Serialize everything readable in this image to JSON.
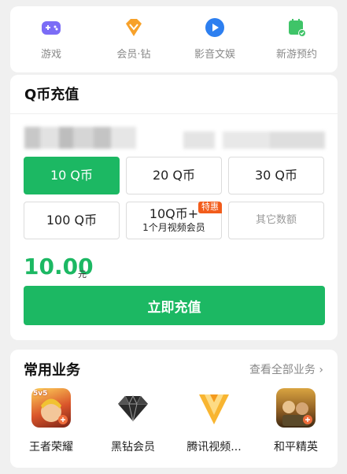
{
  "top_nav": {
    "items": [
      {
        "label": "游戏",
        "icon": "gamepad-icon",
        "color": "#7b6cf6"
      },
      {
        "label": "会员·钻",
        "icon": "diamond-icon",
        "color": "#f7a12a"
      },
      {
        "label": "影音文娱",
        "icon": "play-icon",
        "color": "#2d7ff0"
      },
      {
        "label": "新游预约",
        "icon": "calendar-check-icon",
        "color": "#3fc468"
      }
    ]
  },
  "recharge": {
    "title": "Q币充值",
    "options": [
      {
        "label": "10 Q币",
        "selected": true
      },
      {
        "label": "20 Q币"
      },
      {
        "label": "30 Q币"
      },
      {
        "label": "100 Q币"
      },
      {
        "label": "10Q币+",
        "sub": "1个月视频会员",
        "tag": "特惠"
      },
      {
        "label": "其它数额"
      }
    ],
    "price": "10.00",
    "price_unit": "元",
    "pay_label": "立即充值"
  },
  "services": {
    "title": "常用业务",
    "view_all": "查看全部业务 ›",
    "items": [
      {
        "label": "王者荣耀",
        "icon": "honor-of-kings-icon",
        "badge": "5v5"
      },
      {
        "label": "黑钻会员",
        "icon": "black-diamond-icon"
      },
      {
        "label": "腾讯视频...",
        "icon": "tencent-video-icon"
      },
      {
        "label": "和平精英",
        "icon": "peace-elite-icon"
      }
    ]
  },
  "colors": {
    "accent": "#1cb863",
    "tag": "#f25c1b"
  }
}
